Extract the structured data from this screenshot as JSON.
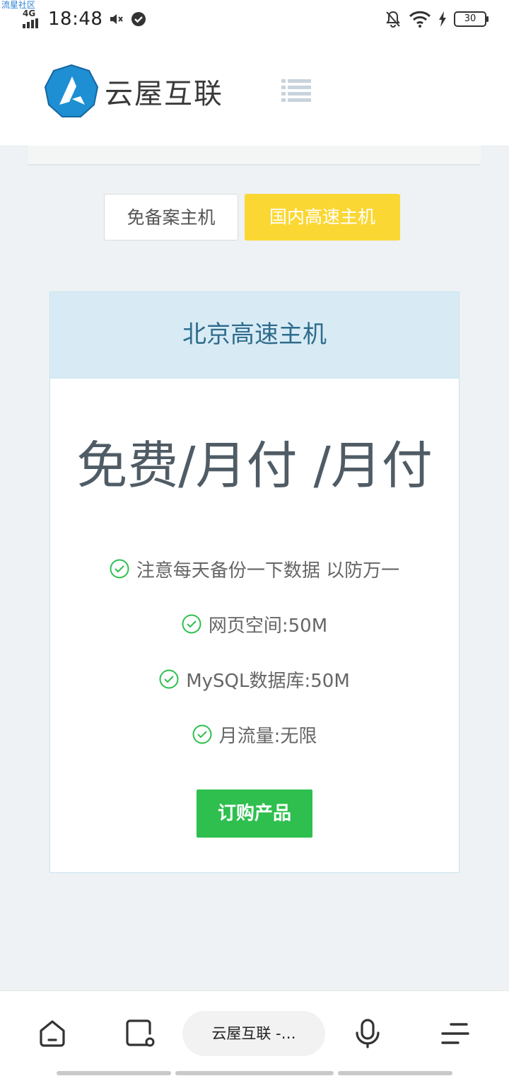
{
  "watermark": "流星社区",
  "status_bar": {
    "network": "4G",
    "time": "18:48",
    "battery": "30"
  },
  "header": {
    "logo_text": "云屋互联"
  },
  "tabs": [
    {
      "label": "免备案主机",
      "active": false
    },
    {
      "label": "国内高速主机",
      "active": true
    }
  ],
  "plan": {
    "title": "北京高速主机",
    "price": "免费/月付 /月付",
    "features": [
      "注意每天备份一下数据 以防万一",
      "网页空间:50M",
      "MySQL数据库:50M",
      "月流量:无限"
    ],
    "order_label": "订购产品"
  },
  "browser_bar": {
    "address": "云屋互联 -…"
  },
  "colors": {
    "tab_active": "#fbd733",
    "order_button": "#2ebf4f",
    "card_header": "#d8ebf5",
    "check": "#2ebf4f"
  }
}
